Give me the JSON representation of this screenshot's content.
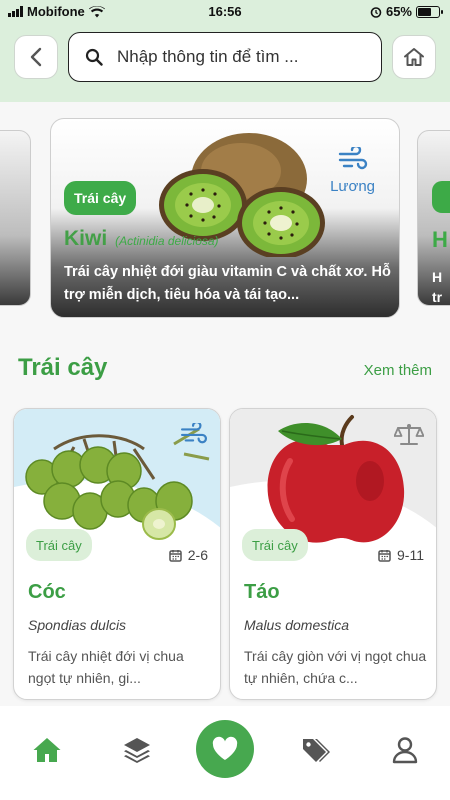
{
  "status_bar": {
    "carrier": "Mobifone",
    "time": "16:56",
    "battery": "65%",
    "battery_level": 0.65
  },
  "search": {
    "placeholder": "Nhập thông tin để tìm ..."
  },
  "hero": {
    "tag": "Trái cây",
    "season_label": "Lương",
    "name": "Kiwi",
    "scientific": "(Actinidia deliciosa)",
    "description": "Trái cây nhiệt đới giàu vitamin C và chất xơ. Hỗ trợ miễn dịch, tiêu hóa và tái tạo..."
  },
  "side_right": {
    "letter": "H",
    "text": "H\ntr"
  },
  "section": {
    "title": "Trái cây",
    "more": "Xem thêm"
  },
  "products": [
    {
      "tag": "Trái cây",
      "months": "2-6",
      "name": "Cóc",
      "scientific": "Spondias dulcis",
      "description": "Trái cây nhiệt đới vị chua ngọt tự nhiên, gi..."
    },
    {
      "tag": "Trái cây",
      "months": "9-11",
      "name": "Táo",
      "scientific": "Malus domestica",
      "description": "Trái cây giòn với vị ngọt chua tự nhiên, chứa c..."
    }
  ],
  "nav": {
    "items": [
      "home-icon",
      "layers-icon",
      "heart-icon",
      "tags-icon",
      "user-icon"
    ]
  },
  "colors": {
    "accent": "#3eab49",
    "header_bg": "#dcefdc",
    "season_blue": "#3b82c4"
  }
}
